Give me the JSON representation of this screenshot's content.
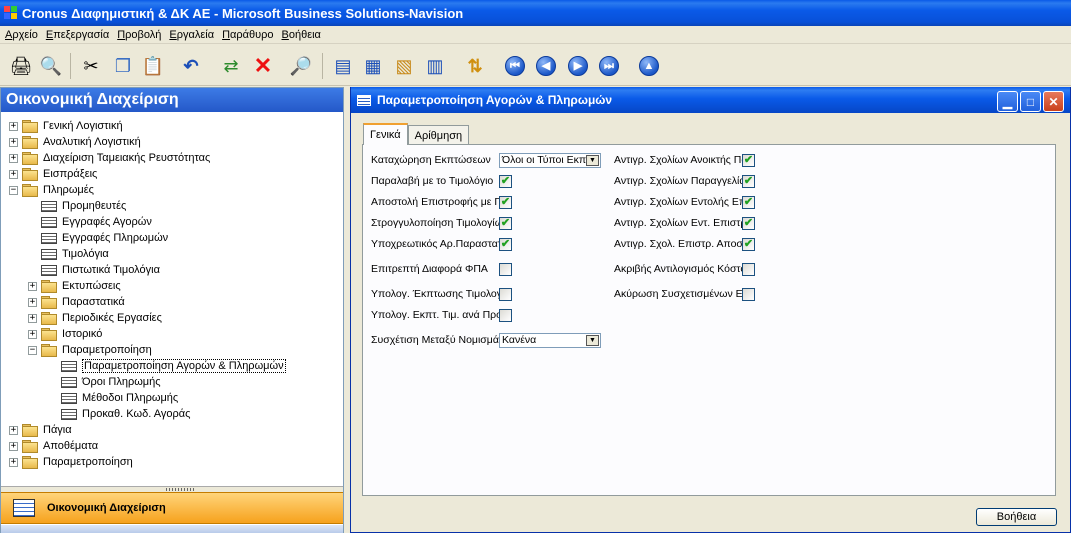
{
  "window": {
    "title": "Cronus Διαφημιστική & ΔΚ ΑΕ - Microsoft Business Solutions-Navision"
  },
  "menu": [
    "Αρχείο",
    "Επεξεργασία",
    "Προβολή",
    "Εργαλεία",
    "Παράθυρο",
    "Βοήθεια"
  ],
  "toolbar": {
    "icons": [
      "print-icon",
      "print-preview-icon",
      "cut-icon",
      "copy-icon",
      "paste-icon",
      "undo-icon",
      "refresh-icon",
      "delete-icon",
      "find-icon",
      "list-icon",
      "card-icon",
      "form-icon",
      "table-icon",
      "sort-icon",
      "first-record-icon",
      "previous-record-icon",
      "next-record-icon",
      "last-record-icon",
      "up-icon"
    ]
  },
  "nav_pane": {
    "header": "Οικονομική Διαχείριση",
    "tree": [
      {
        "label": "Γενική Λογιστική",
        "level": 0,
        "type": "folder",
        "expander": "+"
      },
      {
        "label": "Αναλυτική Λογιστική",
        "level": 0,
        "type": "folder",
        "expander": "+"
      },
      {
        "label": "Διαχείριση Ταμειακής Ρευστότητας",
        "level": 0,
        "type": "folder",
        "expander": "+"
      },
      {
        "label": "Εισπράξεις",
        "level": 0,
        "type": "folder",
        "expander": "+"
      },
      {
        "label": "Πληρωμές",
        "level": 0,
        "type": "folder",
        "expander": "−"
      },
      {
        "label": "Προμηθευτές",
        "level": 1,
        "type": "form"
      },
      {
        "label": "Εγγραφές Αγορών",
        "level": 1,
        "type": "form"
      },
      {
        "label": "Εγγραφές Πληρωμών",
        "level": 1,
        "type": "form"
      },
      {
        "label": "Τιμολόγια",
        "level": 1,
        "type": "form"
      },
      {
        "label": "Πιστωτικά Τιμολόγια",
        "level": 1,
        "type": "form"
      },
      {
        "label": "Εκτυπώσεις",
        "level": 1,
        "type": "folder",
        "expander": "+"
      },
      {
        "label": "Παραστατικά",
        "level": 1,
        "type": "folder",
        "expander": "+"
      },
      {
        "label": "Περιοδικές Εργασίες",
        "level": 1,
        "type": "folder",
        "expander": "+"
      },
      {
        "label": "Ιστορικό",
        "level": 1,
        "type": "folder",
        "expander": "+"
      },
      {
        "label": "Παραμετροποίηση",
        "level": 1,
        "type": "folder",
        "expander": "−"
      },
      {
        "label": "Παραμετροποίηση Αγορών & Πληρωμών",
        "level": 2,
        "type": "form",
        "selected": true
      },
      {
        "label": "Όροι Πληρωμής",
        "level": 2,
        "type": "form"
      },
      {
        "label": "Μέθοδοι Πληρωμής",
        "level": 2,
        "type": "form"
      },
      {
        "label": "Προκαθ. Κωδ. Αγοράς",
        "level": 2,
        "type": "form"
      },
      {
        "label": "Πάγια",
        "level": 0,
        "type": "folder",
        "expander": "+"
      },
      {
        "label": "Αποθέματα",
        "level": 0,
        "type": "folder",
        "expander": "+"
      },
      {
        "label": "Παραμετροποίηση",
        "level": 0,
        "type": "folder",
        "expander": "+"
      }
    ],
    "bottom_button": "Οικονομική Διαχείριση"
  },
  "form": {
    "title": "Παραμετροποίηση Αγορών & Πληρωμών",
    "tabs": [
      "Γενικά",
      "Αρίθμηση"
    ],
    "active_tab": "Γενικά",
    "left_fields": [
      {
        "label": "Καταχώρηση Εκπτώσεων",
        "type": "combo",
        "value": "Όλοι οι Τύποι Εκπ"
      },
      {
        "label": "Παραλαβή με το Τιμολόγιο",
        "type": "check",
        "checked": true
      },
      {
        "label": "Αποστολή Επιστροφής με Πιστωτικό",
        "type": "check",
        "checked": true
      },
      {
        "label": "Στρογγυλοποίηση Τιμολογίων",
        "type": "check",
        "checked": true
      },
      {
        "label": "Υποχρεωτικός Αρ.Παραστατικού",
        "type": "check",
        "checked": true
      },
      {
        "label": "Επιτρεπτή Διαφορά ΦΠΑ",
        "type": "check",
        "checked": false
      },
      {
        "label": "Υπολογ. Έκπτωσης Τιμολογίου",
        "type": "check",
        "checked": false
      },
      {
        "label": "Υπολογ. Εκπτ. Τιμ. ανά Προμηθευτή",
        "type": "check",
        "checked": false
      },
      {
        "label": "Συσχέτιση Μεταξύ Νομισμάτων",
        "type": "combo",
        "value": "Κανένα"
      }
    ],
    "right_fields": [
      {
        "label": "Αντιγρ. Σχολίων Ανοικτής Παραγγελίας",
        "checked": true
      },
      {
        "label": "Αντιγρ. Σχολίων Παραγγελίας",
        "checked": true
      },
      {
        "label": "Αντιγρ. Σχολίων Εντολής Επιστροφής",
        "checked": true
      },
      {
        "label": "Αντιγρ. Σχολίων Εντ. Επιστροφής",
        "checked": true
      },
      {
        "label": "Αντιγρ. Σχολ. Επιστρ. Αποστολής",
        "checked": true
      },
      {
        "label": "Ακριβής Αντιλογισμός Κόστους",
        "checked": false
      },
      {
        "label": "Ακύρωση Συσχετισμένων Εγγραφών",
        "checked": false
      }
    ],
    "help_button": "Βοήθεια"
  }
}
